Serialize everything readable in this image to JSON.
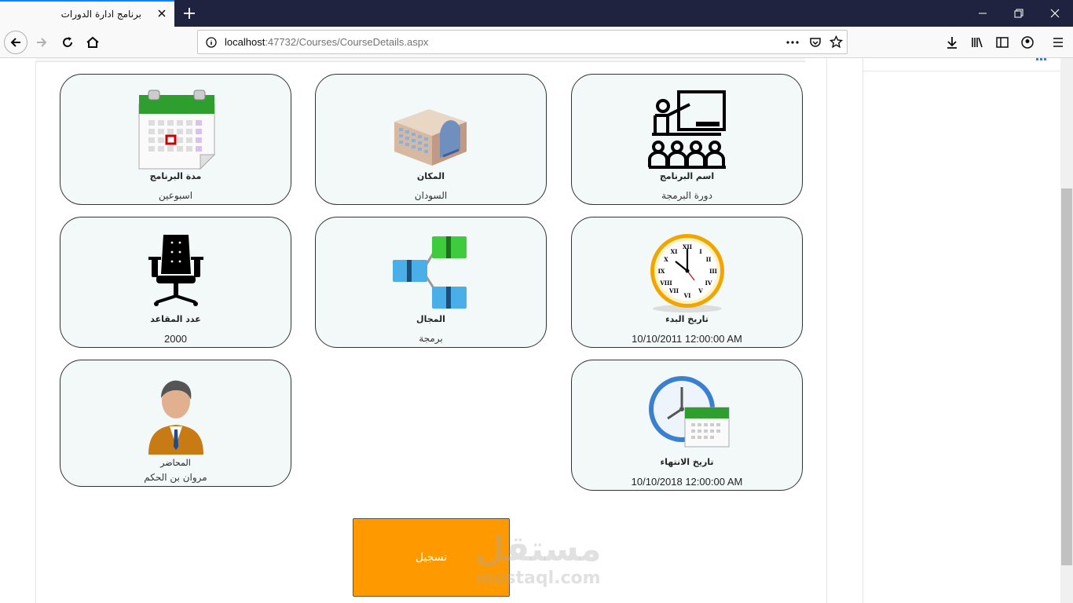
{
  "browser": {
    "tab_title": "برنامج ادارة الدورات",
    "url_host": "localhost",
    "url_rest": ":47732/Courses/CourseDetails.aspx"
  },
  "cards": {
    "program_name": {
      "label": "اسم البرنامج",
      "value": "دورة البرمجة",
      "icon": "teacher-classroom-icon"
    },
    "location": {
      "label": "المكان",
      "value": "السودان",
      "icon": "building-icon"
    },
    "duration": {
      "label": "مدة البرنامج",
      "value": "اسبوعين",
      "icon": "calendar-icon"
    },
    "start_date": {
      "label": "تاريخ البدء",
      "value": "10/10/2011 12:00:00 AM",
      "icon": "clock-icon"
    },
    "field": {
      "label": "المجال",
      "value": "برمجة",
      "icon": "flow-diagram-icon"
    },
    "seats": {
      "label": "عدد المقاعد",
      "value": "2000",
      "icon": "office-chair-icon"
    },
    "end_date": {
      "label": "تاريخ الانتهاء",
      "value": "10/10/2018 12:00:00 AM",
      "icon": "clock-calendar-icon"
    },
    "lecturer": {
      "label": "المحاضر",
      "value": "مروان بن الحكم",
      "icon": "person-avatar-icon"
    }
  },
  "register_button": {
    "label": "تسجيل"
  },
  "watermark": {
    "arabic": "مستقل",
    "latin": "mostaql.com"
  },
  "colors": {
    "accent": "#ff9900",
    "card_bg": "#f3f9f9",
    "titlebar": "#202340"
  }
}
